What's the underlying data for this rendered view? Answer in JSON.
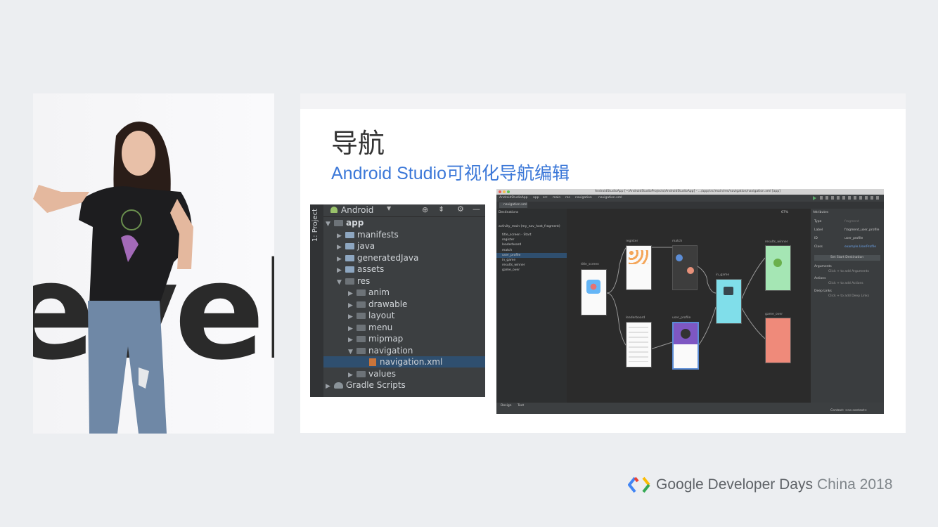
{
  "slide": {
    "title": "导航",
    "subtitle": "Android Studio可视化导航编辑"
  },
  "project_panel": {
    "side_tab": "1: Project",
    "view_label": "Android",
    "tree": [
      {
        "label": "app",
        "depth": 0,
        "expanded": true
      },
      {
        "label": "manifests",
        "depth": 1,
        "expanded": false
      },
      {
        "label": "java",
        "depth": 1,
        "expanded": false
      },
      {
        "label": "generatedJava",
        "depth": 1,
        "expanded": false
      },
      {
        "label": "assets",
        "depth": 1,
        "expanded": false
      },
      {
        "label": "res",
        "depth": 1,
        "expanded": true
      },
      {
        "label": "anim",
        "depth": 2,
        "expanded": false
      },
      {
        "label": "drawable",
        "depth": 2,
        "expanded": false
      },
      {
        "label": "layout",
        "depth": 2,
        "expanded": false
      },
      {
        "label": "menu",
        "depth": 2,
        "expanded": false
      },
      {
        "label": "mipmap",
        "depth": 2,
        "expanded": false
      },
      {
        "label": "navigation",
        "depth": 2,
        "expanded": true
      },
      {
        "label": "navigation.xml",
        "depth": 3,
        "selected": true
      },
      {
        "label": "values",
        "depth": 2,
        "expanded": false
      },
      {
        "label": "Gradle Scripts",
        "depth": 0,
        "expanded": false
      }
    ]
  },
  "ide": {
    "window_title": "AndroidStudioApp [~/AndroidStudioProjects/AndroidStudioApp] - .../app/src/main/res/navigation/navigation.xml [app]",
    "breadcrumb": [
      "AndroidStudioApp",
      "app",
      "src",
      "main",
      "res",
      "navigation",
      "navigation.xml"
    ],
    "tab": "navigation.xml",
    "destinations_header": "Destinations",
    "host": "activity_main (my_nav_host_fragment)",
    "destinations": [
      "title_screen - Start",
      "register",
      "leaderboard",
      "match",
      "user_profile",
      "in_game",
      "results_winner",
      "game_over"
    ],
    "zoom": "67%",
    "attributes_header": "Attributes",
    "attributes": [
      {
        "label": "Type",
        "value": "fragment"
      },
      {
        "label": "Label",
        "value": "fragment_user_profile"
      },
      {
        "label": "ID",
        "value": "user_profile"
      },
      {
        "label": "Class",
        "value": "example.UserProfile"
      }
    ],
    "set_start": "Set Start Destination",
    "sections": [
      {
        "title": "Arguments",
        "hint": "Click + to add Arguments"
      },
      {
        "title": "Actions",
        "hint": "Click + to add Actions"
      },
      {
        "title": "Deep Links",
        "hint": "Click + to add Deep Links"
      }
    ],
    "bottom_tabs": [
      "Design",
      "Text"
    ],
    "status": "Context: <no context>",
    "nodes": [
      "title_screen",
      "register",
      "match",
      "in_game",
      "results_winner",
      "game_over",
      "leaderboard",
      "user_profile"
    ]
  },
  "footer": {
    "brand": "Google Developer Days",
    "region": "China 2018",
    "logo_colors": [
      "#4285f4",
      "#ea4335",
      "#fbbc04",
      "#34a853"
    ]
  },
  "speaker_backdrop": "evel"
}
